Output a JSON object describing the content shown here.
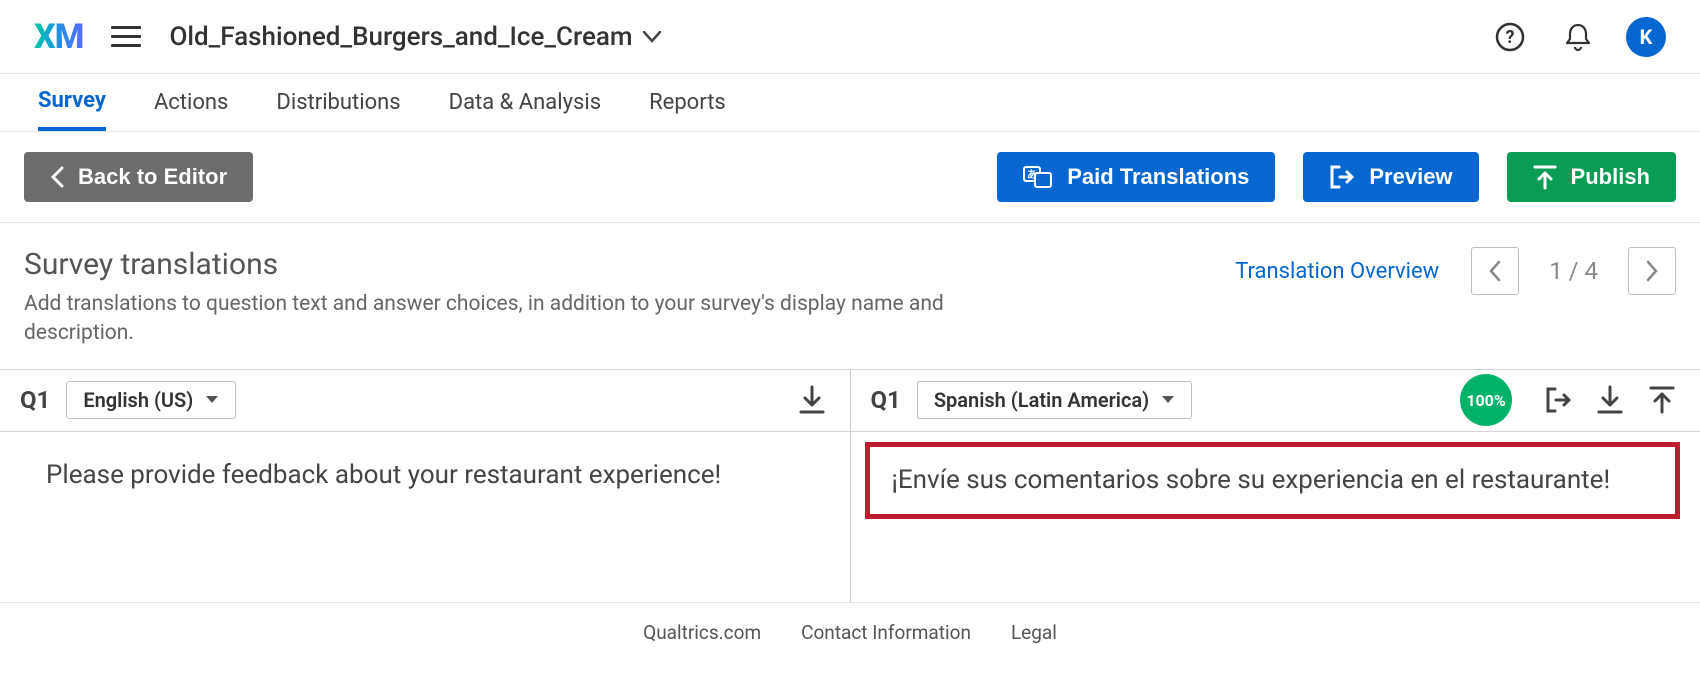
{
  "header": {
    "logo": "XM",
    "project_name": "Old_Fashioned_Burgers_and_Ice_Cream",
    "avatar_initial": "K"
  },
  "nav": {
    "tabs": [
      "Survey",
      "Actions",
      "Distributions",
      "Data & Analysis",
      "Reports"
    ],
    "active": "Survey"
  },
  "toolbar": {
    "back_label": "Back to Editor",
    "paid_translations_label": "Paid Translations",
    "preview_label": "Preview",
    "publish_label": "Publish"
  },
  "section": {
    "title": "Survey translations",
    "description": "Add translations to question text and answer choices, in addition to your survey's display name and description.",
    "overview_link": "Translation Overview",
    "page_indicator": "1 / 4"
  },
  "question": {
    "id": "Q1",
    "source": {
      "language_label": "English (US)",
      "text": "Please provide feedback about your restaurant experience!"
    },
    "target": {
      "language_label": "Spanish (Latin America)",
      "completion": "100%",
      "text": "¡Envíe sus comentarios sobre su experiencia en el restaurante!"
    }
  },
  "footer": {
    "links": [
      "Qualtrics.com",
      "Contact Information",
      "Legal"
    ]
  }
}
